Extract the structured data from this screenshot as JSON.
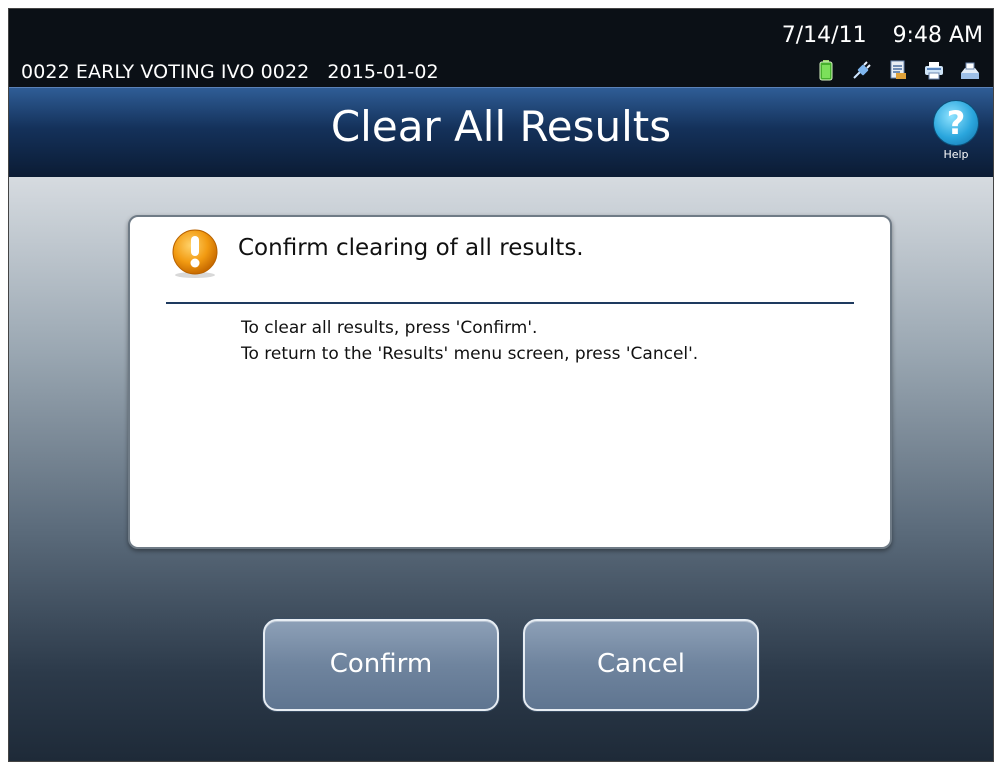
{
  "status_bar": {
    "station": "0022 EARLY VOTING IVO 0022",
    "election_date": "2015-01-02",
    "date": "7/14/11",
    "time": "9:48 AM",
    "icons": [
      "battery-icon",
      "power-plug-icon",
      "document-icon",
      "printer-icon",
      "paper-tray-icon"
    ]
  },
  "header": {
    "title": "Clear All Results",
    "help_label": "Help",
    "help_glyph": "?"
  },
  "dialog": {
    "heading": "Confirm clearing of all results.",
    "line1": "To clear all results, press 'Confirm'.",
    "line2": "To return to the 'Results' menu screen, press 'Cancel'."
  },
  "buttons": {
    "confirm_label": "Confirm",
    "cancel_label": "Cancel"
  },
  "colors": {
    "accent_title": "#14315a",
    "warning": "#f29b12",
    "help": "#2aa6dd",
    "button": "#6f849e"
  }
}
